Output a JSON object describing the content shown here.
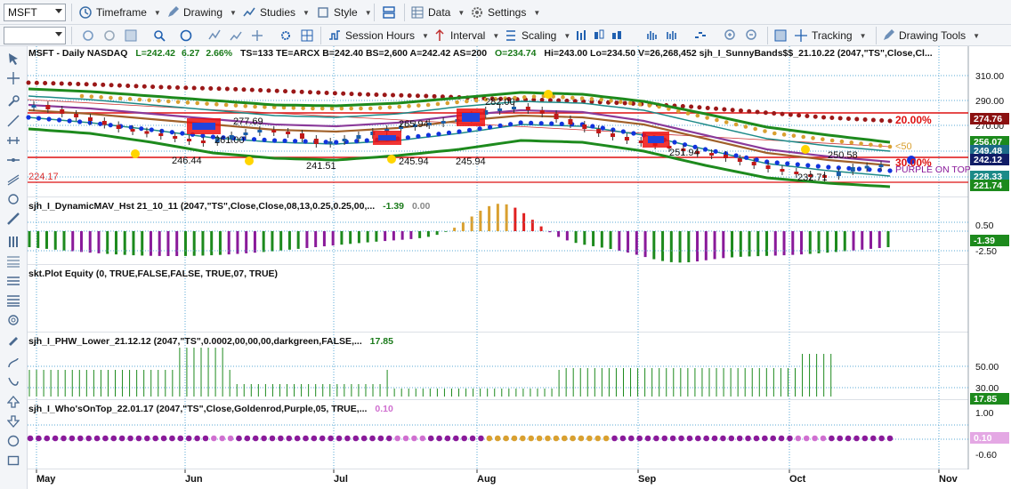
{
  "toolbar": {
    "symbol": "MSFT",
    "menu": [
      "Timeframe",
      "Drawing",
      "Studies",
      "Style",
      "Data",
      "Settings"
    ],
    "row2": [
      "Session Hours",
      "Interval",
      "Scaling",
      "Tracking",
      "Drawing Tools"
    ]
  },
  "header": {
    "symbol_info": "MSFT - Daily  NASDAQ",
    "L": "L=242.42",
    "chg": "6.27",
    "pct": "2.66%",
    "rest": "TS=133  TE=ARCX  B=242.40  BS=2,600  A=242.42  AS=200",
    "O": "O=234.74",
    "tail": "Hi=243.00  Lo=234.50  V=26,268,452  sjh_I_SunnyBands$$_21.10.22 (2047,\"TS\",Close,Cl..."
  },
  "panels": {
    "p2_title": "sjh_I_DynamicMAV_Hst 21_10_11 (2047,\"TS\",Close,Close,08,13,0.25,0.25,00,...",
    "p2_v1": "-1.39",
    "p2_v2": "0.00",
    "p3_title": "skt.Plot Equity (0, TRUE,FALSE,FALSE, TRUE,07, TRUE)",
    "p4_title": "sjh_I_PHW_Lower_21.12.12 (2047,\"TS\",0.0002,00,00,00,darkgreen,FALSE,...",
    "p4_v1": "17.85",
    "p5_title": "sjh_I_Who'sOnTop_22.01.17 (2047,\"TS\",Close,Goldenrod,Purple,05, TRUE,...",
    "p5_v1": "0.10"
  },
  "price_labels": [
    "246.44",
    "241.51",
    "245.94",
    "245.94",
    "282.00",
    "265.94",
    "251.94",
    "250.58",
    "232.71",
    "224.17",
    "277.69",
    "261.00"
  ],
  "annotations": {
    "pct_top": "20.00%",
    "pct_mid": "30.00%",
    "lt50": "<50",
    "purple_on_top": "PURPLE ON TOP"
  },
  "right_axis": {
    "ticks": [
      "310.00",
      "290.00",
      "270.00",
      "250.00",
      "230.00"
    ],
    "badges": [
      "274.76",
      "256.07",
      "249.48",
      "242.12",
      "228.33",
      "221.74"
    ],
    "p2_ticks": [
      "0.50",
      "-2.50"
    ],
    "p2_badge": "-1.39",
    "p4_ticks": [
      "50.00",
      "30.00"
    ],
    "p4_badge": "17.85",
    "p5_ticks": [
      "1.00",
      "-0.60"
    ],
    "p5_badge": "0.10"
  },
  "months": [
    "May",
    "Jun",
    "Jul",
    "Aug",
    "Sep",
    "Oct",
    "Nov"
  ],
  "colors": {
    "up": "#1a8a1a",
    "down": "#8a1a9a",
    "gold": "#d9a030",
    "red": "#dd1111",
    "blue": "#1133dd",
    "darkred": "#8b1111",
    "green": "#1d8a1d"
  }
}
